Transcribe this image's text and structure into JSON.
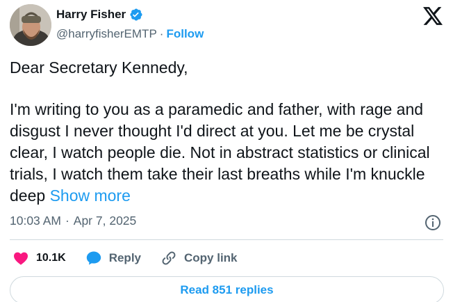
{
  "author": {
    "name": "Harry Fisher",
    "handle": "@harryfisherEMTP",
    "separator": "·",
    "follow_label": "Follow"
  },
  "tweet": {
    "greeting": "Dear Secretary Kennedy,",
    "body": "I'm writing to you as a paramedic and father, with rage and disgust I never thought I'd direct at you. Let me be crystal clear, I watch people die. Not in abstract statistics or clinical trials, I watch them take their last breaths while I'm knuckle deep",
    "show_more_label": "Show more",
    "time": "10:03 AM",
    "meta_separator": "·",
    "date": "Apr 7, 2025"
  },
  "actions": {
    "likes": "10.1K",
    "reply_label": "Reply",
    "copy_link_label": "Copy link"
  },
  "read_replies_label": "Read 851 replies",
  "icons": {
    "verified": "verified-badge-icon",
    "x_logo": "x-logo-icon",
    "info": "info-icon",
    "heart": "heart-icon",
    "reply": "reply-bubble-icon",
    "link": "link-icon"
  },
  "colors": {
    "accent": "#1d9bf0",
    "heart": "#f91880",
    "text": "#0f1419",
    "muted": "#536471",
    "border": "#cfd9de"
  }
}
